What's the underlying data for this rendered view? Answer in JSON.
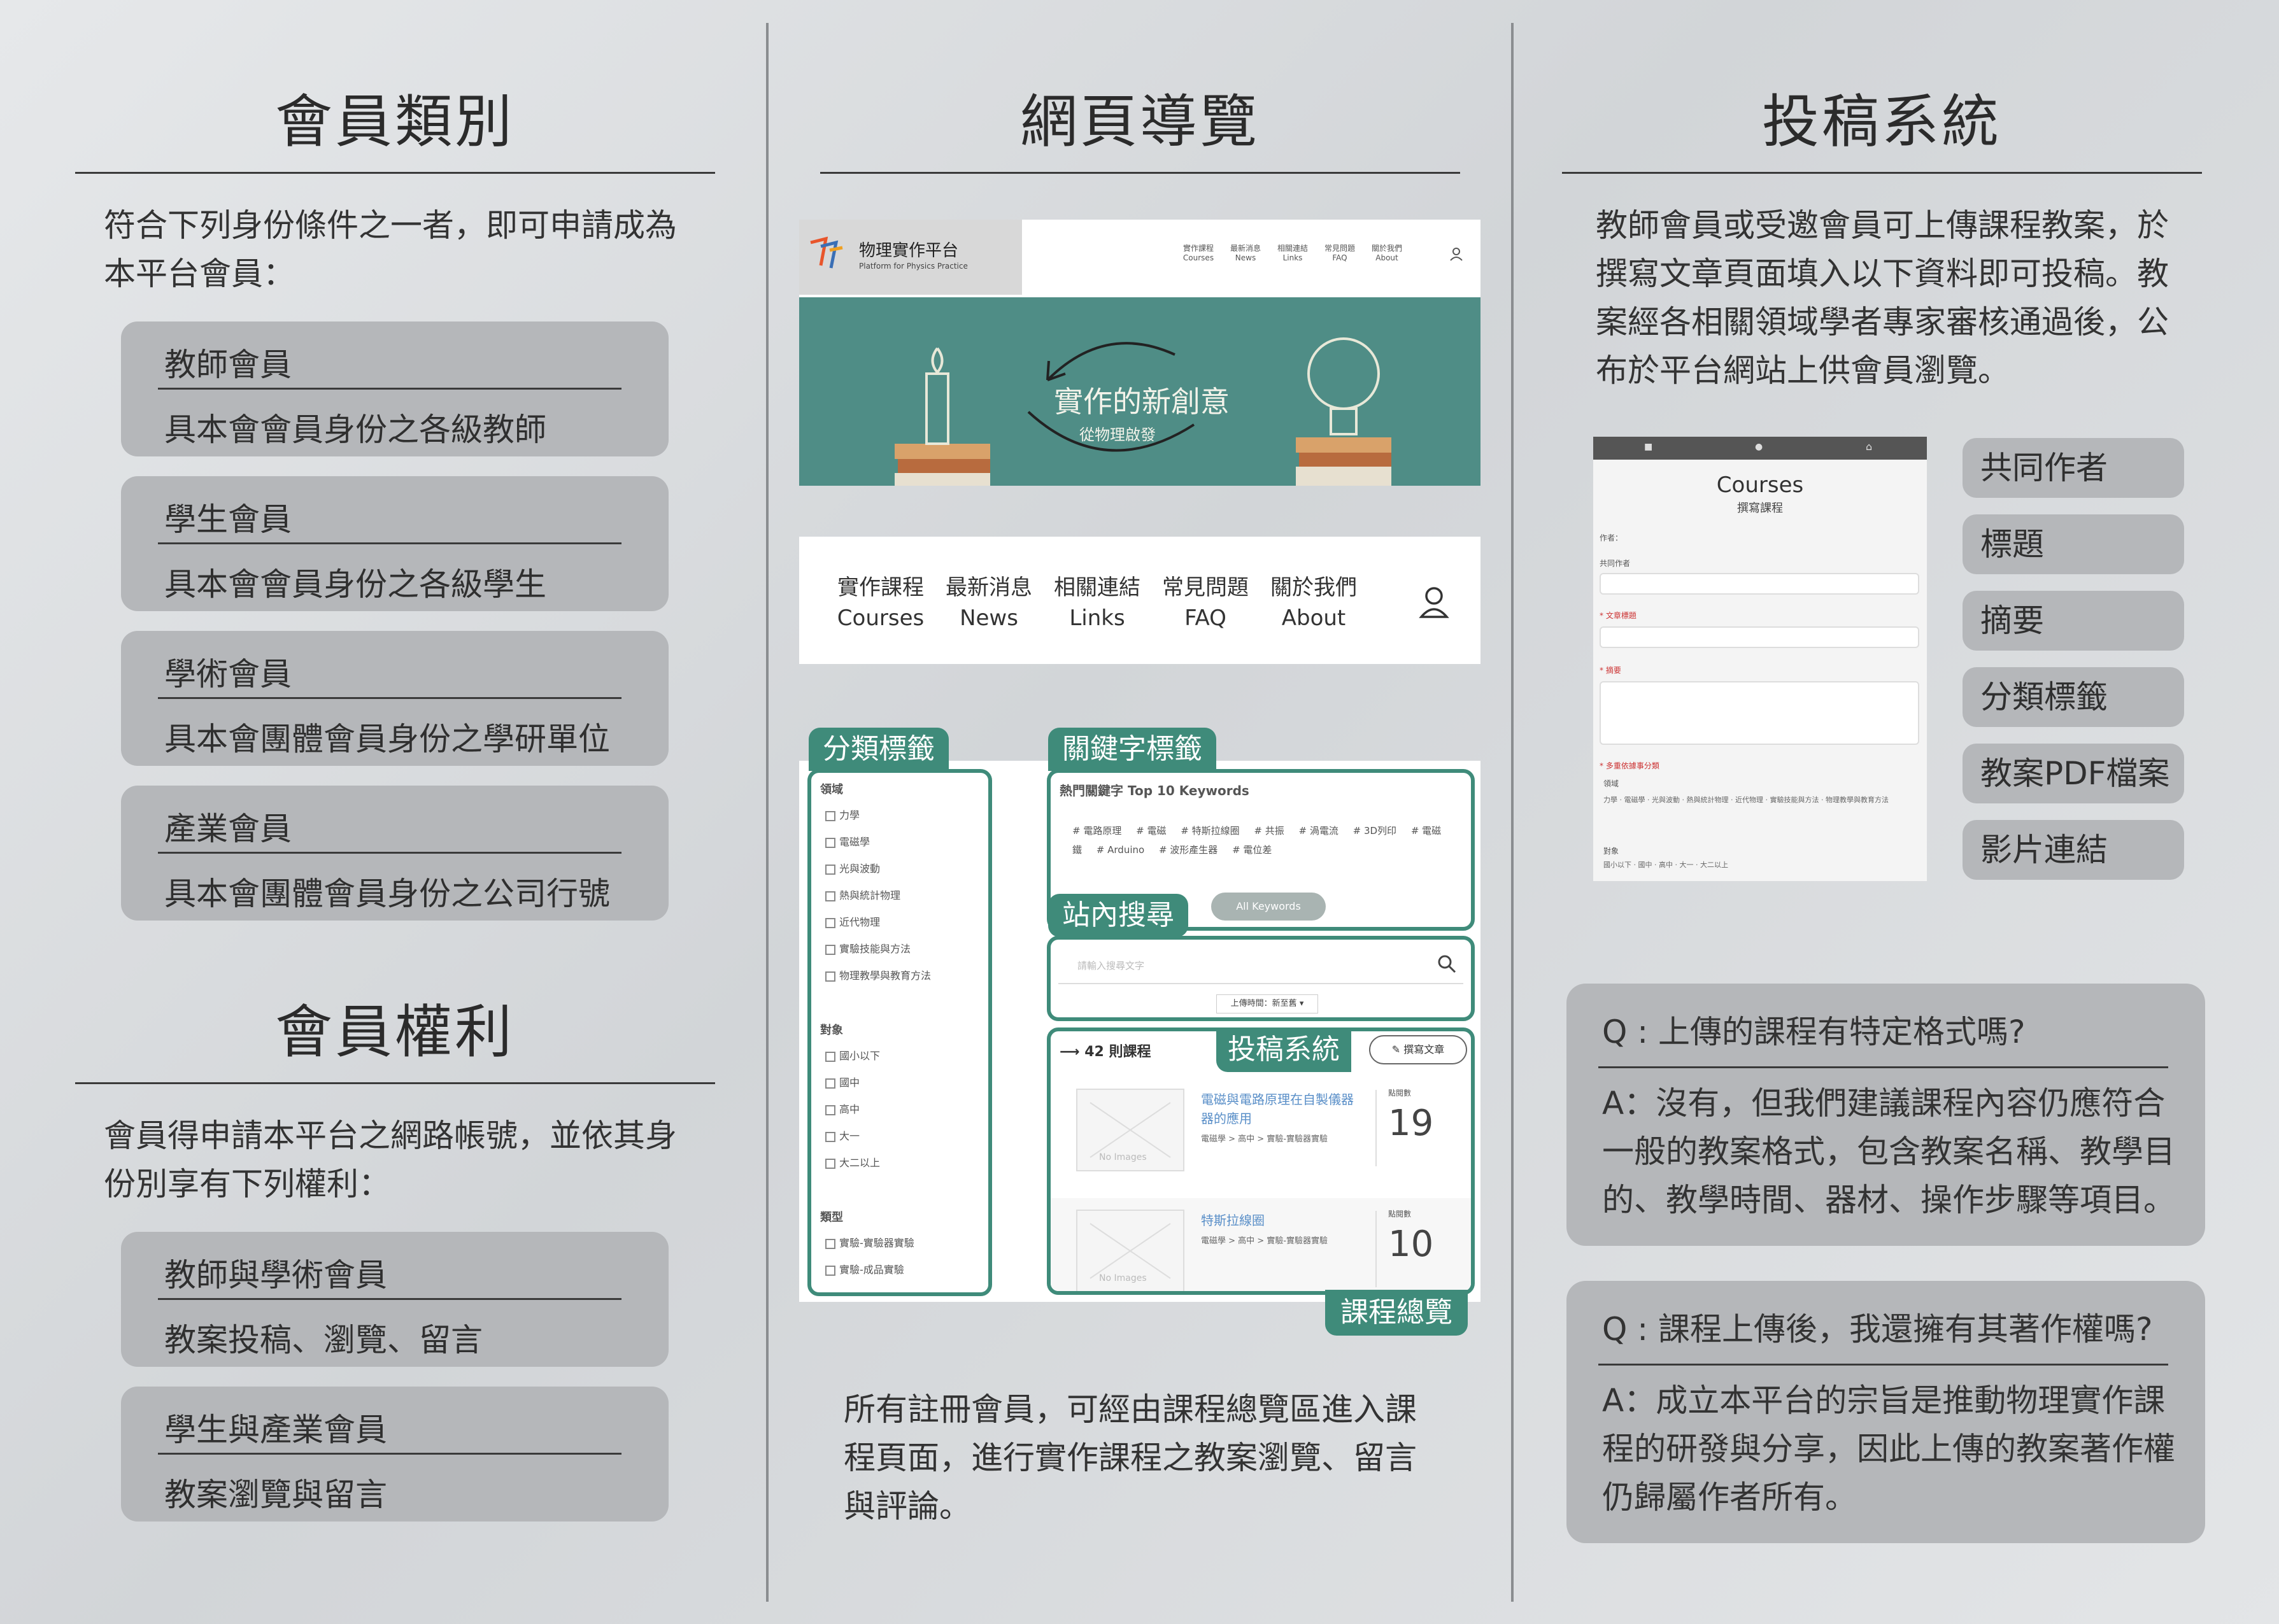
{
  "members": {
    "title": "會員類別",
    "intro": "符合下列身份條件之一者，即可申請成為本平台會員：",
    "cards": [
      {
        "name": "教師會員",
        "desc": "具本會會員身份之各級教師"
      },
      {
        "name": "學生會員",
        "desc": "具本會會員身份之各級學生"
      },
      {
        "name": "學術會員",
        "desc": "具本會團體會員身份之學研單位"
      },
      {
        "name": "產業會員",
        "desc": "具本會團體會員身份之公司行號"
      }
    ]
  },
  "rights": {
    "title": "會員權利",
    "intro": "會員得申請本平台之網路帳號，並依其身份別享有下列權利：",
    "cards": [
      {
        "name": "教師與學術會員",
        "desc": "教案投稿、瀏覽、留言"
      },
      {
        "name": "學生與產業會員",
        "desc": "教案瀏覽與留言"
      }
    ]
  },
  "nav": {
    "title": "網頁導覽",
    "site": {
      "name": "物理實作平台",
      "subname": "Platform for Physics Practice",
      "banner_text": "實作的新創意",
      "banner_sub": "從物理啟發"
    },
    "menu": [
      {
        "zh": "實作課程",
        "en": "Courses"
      },
      {
        "zh": "最新消息",
        "en": "News"
      },
      {
        "zh": "相關連結",
        "en": "Links"
      },
      {
        "zh": "常見問題",
        "en": "FAQ"
      },
      {
        "zh": "關於我們",
        "en": "About"
      }
    ],
    "labels": {
      "category": "分類標籤",
      "keyword": "關鍵字標籤",
      "search": "站內搜尋",
      "submit": "投稿系統",
      "overview": "課程總覽"
    },
    "filters": {
      "domain_title": "領域",
      "domain": [
        "力學",
        "電磁學",
        "光與波動",
        "熱與統計物理",
        "近代物理",
        "實驗技能與方法",
        "物理教學與教育方法"
      ],
      "target_title": "對象",
      "target": [
        "國小以下",
        "國中",
        "高中",
        "大一",
        "大二以上"
      ],
      "type_title": "類型",
      "type": [
        "實驗-實驗器實驗",
        "實驗-成品實驗"
      ]
    },
    "keywords_title": "熱門關鍵字 Top 10 Keywords",
    "keywords": [
      "# 電路原理",
      "# 電磁",
      "# 特斯拉線圈",
      "# 共振",
      "# 渦電流",
      "# 3D列印",
      "# 電磁鐵",
      "# Arduino",
      "# 波形產生器",
      "# 電位差"
    ],
    "all_keywords": "All Keywords",
    "search_placeholder": "請輸入搜尋文字",
    "sort_label": "上傳時間：新至舊",
    "course_count": "42 則課程",
    "write_btn": "撰寫文章",
    "courses": [
      {
        "title": "電磁與電路原理在自製儀器器的應用",
        "path": "電磁學 > 高中 > 實驗-實驗器實驗",
        "views_label": "點閱數",
        "views": "19",
        "no_image": "No Images"
      },
      {
        "title": "特斯拉線圈",
        "path": "電磁學 > 高中 > 實驗-實驗器實驗",
        "views_label": "點閱數",
        "views": "10",
        "no_image": "No Images"
      }
    ],
    "outro": "所有註冊會員，可經由課程總覽區進入課程頁面，進行實作課程之教案瀏覽、留言與評論。"
  },
  "submit": {
    "title": "投稿系統",
    "intro": "教師會員或受邀會員可上傳課程教案，於撰寫文章頁面填入以下資料即可投稿。教案經各相關領域學者專家審核通過後，公布於平台網站上供會員瀏覽。",
    "form": {
      "heading": "Courses",
      "subheading": "撰寫課程",
      "author": "作者：",
      "coauthor": "共同作者",
      "title_field": "* 文章標題",
      "abstract": "* 摘要",
      "category": "* 多重依據事分類",
      "domain_row": "領域",
      "target_row": "對象"
    },
    "fields": [
      "共同作者",
      "標題",
      "摘要",
      "分類標籤",
      "教案PDF檔案",
      "影片連結"
    ],
    "faq": [
      {
        "q": "Q : 上傳的課程有特定格式嗎?",
        "a": "A：沒有，但我們建議課程內容仍應符合一般的教案格式，包含教案名稱、教學目的、教學時間、器材、操作步驟等項目。"
      },
      {
        "q": "Q : 課程上傳後，我還擁有其著作權嗎?",
        "a": "A：成立本平台的宗旨是推動物理實作課程的研發與分享，因此上傳的教案著作權仍歸屬作者所有。"
      }
    ]
  }
}
